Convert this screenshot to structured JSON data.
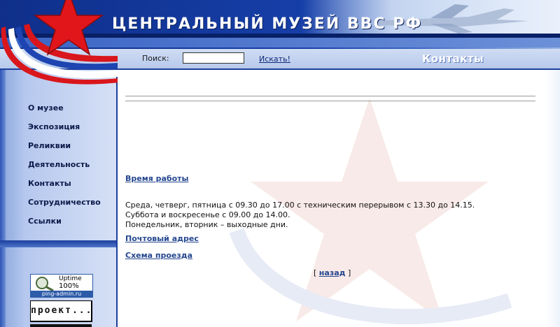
{
  "header": {
    "site_title": "ЦЕНТРАЛЬНЫЙ МУЗЕЙ ВВС РФ"
  },
  "search": {
    "label": "Поиск:",
    "value": "",
    "placeholder": "",
    "submit_label": "Искать!"
  },
  "section": {
    "title": "Контакты"
  },
  "sidebar": {
    "items": [
      {
        "label": "О музее"
      },
      {
        "label": "Экспозиция"
      },
      {
        "label": "Реликвии"
      },
      {
        "label": "Деятельность"
      },
      {
        "label": "Контакты"
      },
      {
        "label": "Сотрудничество"
      },
      {
        "label": "Ссылки"
      }
    ],
    "badges": {
      "uptime_title": "Uptime",
      "uptime_value": "100%",
      "uptime_site": "ping-admin.ru",
      "proekt": "проект..."
    }
  },
  "content": {
    "working_hours_heading": "Время работы",
    "hours_lines": [
      "Среда, четверг, пятница с 09.30 до 17.00 с техническим перерывом с 13.30 до 14.15.",
      "Суббота и воскресенье с 09.00 до 14.00.",
      "Понедельник, вторник – выходные дни."
    ],
    "postal_heading": "Почтовый адрес",
    "route_heading": "Схема проезда",
    "back_open": "[",
    "back_label": "назад",
    "back_close": "]"
  },
  "colors": {
    "brand_blue": "#163fa8",
    "star_red": "#e0161b",
    "link_blue": "#24468f"
  }
}
